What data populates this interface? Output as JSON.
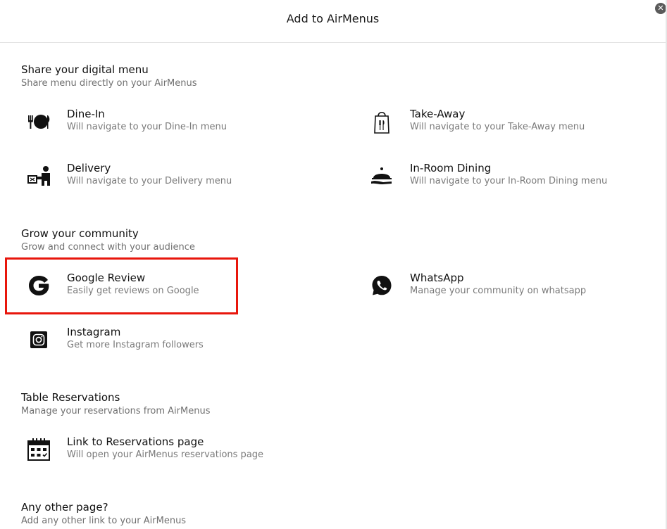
{
  "modal": {
    "title": "Add to AirMenus",
    "close_glyph": "✕"
  },
  "sections": {
    "share": {
      "title": "Share your digital menu",
      "subtitle": "Share menu directly on your AirMenus",
      "items": [
        {
          "label": "Dine-In",
          "desc": "Will navigate to your Dine-In menu",
          "icon": "dine-in-icon"
        },
        {
          "label": "Take-Away",
          "desc": "Will navigate to your Take-Away menu",
          "icon": "take-away-bag-icon"
        },
        {
          "label": "Delivery",
          "desc": "Will navigate to your Delivery menu",
          "icon": "delivery-person-icon"
        },
        {
          "label": "In-Room Dining",
          "desc": "Will navigate to your In-Room Dining menu",
          "icon": "cloche-icon"
        }
      ]
    },
    "community": {
      "title": "Grow your community",
      "subtitle": "Grow and connect with your audience",
      "items": [
        {
          "label": "Google Review",
          "desc": "Easily get reviews on Google",
          "icon": "google-icon"
        },
        {
          "label": "WhatsApp",
          "desc": "Manage your community on whatsapp",
          "icon": "whatsapp-icon"
        },
        {
          "label": "Instagram",
          "desc": "Get more Instagram followers",
          "icon": "instagram-icon"
        }
      ]
    },
    "reservations": {
      "title": "Table Reservations",
      "subtitle": "Manage your reservations from AirMenus",
      "items": [
        {
          "label": "Link to Reservations page",
          "desc": "Will open your AirMenus reservations page",
          "icon": "calendar-icon"
        }
      ]
    },
    "other": {
      "title": "Any other page?",
      "subtitle": "Add any other link to your AirMenus"
    }
  },
  "highlight_color": "#e8160c"
}
